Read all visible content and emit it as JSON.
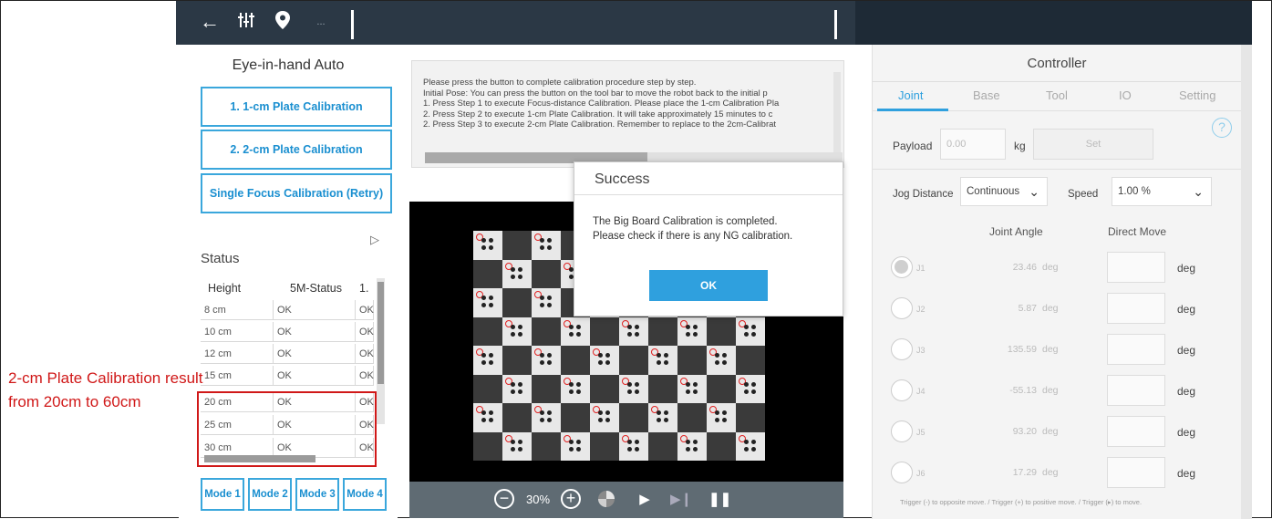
{
  "toolbar": {
    "back_icon": "arrow-left-icon",
    "sliders_icon": "sliders-icon",
    "location_icon": "map-pin-icon",
    "more_label": "..."
  },
  "left_panel": {
    "title": "Eye-in-hand Auto",
    "buttons": [
      "1. 1-cm Plate Calibration",
      "2. 2-cm Plate Calibration",
      "Single Focus Calibration (Retry)"
    ],
    "status_title": "Status",
    "columns": [
      "Height",
      "5M-Status",
      "1."
    ],
    "rows": [
      {
        "height": "8 cm",
        "status": "OK",
        "third": "OK"
      },
      {
        "height": "10 cm",
        "status": "OK",
        "third": "OK"
      },
      {
        "height": "12 cm",
        "status": "OK",
        "third": "OK"
      },
      {
        "height": "15 cm",
        "status": "OK",
        "third": "OK"
      },
      {
        "height": "20 cm",
        "status": "OK",
        "third": "OK"
      },
      {
        "height": "25 cm",
        "status": "OK",
        "third": "OK"
      },
      {
        "height": "30 cm",
        "status": "OK",
        "third": "OK"
      }
    ],
    "modes": [
      "Mode 1",
      "Mode 2",
      "Mode 3",
      "Mode 4"
    ]
  },
  "annotation": {
    "line1": "2-cm Plate Calibration result",
    "line2": "from 20cm to 60cm",
    "color": "#d01818"
  },
  "instructions": [
    "Please press the button to complete calibration procedure step by step.",
    "Initial Pose: You can press the button on the tool bar to move the robot back to the initial p",
    "1. Press Step 1 to execute Focus-distance Calibration. Please place the 1-cm Calibration Pla",
    "2. Press Step 2 to execute 1-cm Plate Calibration. It will take approximately 15 minutes to c",
    "2. Press Step 3 to execute 2-cm Plate Calibration. Remember to replace to the 2cm-Calibrat"
  ],
  "viewer": {
    "zoom": "30%",
    "zoom_out_icon": "zoom-out-icon",
    "zoom_in_icon": "zoom-in-icon"
  },
  "dialog": {
    "title": "Success",
    "line1": "The Big Board Calibration is completed.",
    "line2": "Please check if there is any NG calibration.",
    "ok_label": "OK"
  },
  "controller": {
    "title": "Controller",
    "tabs": [
      "Joint",
      "Base",
      "Tool",
      "IO",
      "Setting"
    ],
    "active_tab": "Joint",
    "help_label": "?",
    "payload_label": "Payload",
    "payload_value": "0.00",
    "payload_unit": "kg",
    "set_label": "Set",
    "jog_label": "Jog Distance",
    "jog_value": "Continuous",
    "speed_label": "Speed",
    "speed_value": "1.00 %",
    "col_angle": "Joint Angle",
    "col_direct": "Direct Move",
    "joints": [
      {
        "name": "J1",
        "value": "23.46",
        "unit": "deg",
        "direct_unit": "deg"
      },
      {
        "name": "J2",
        "value": "5.87",
        "unit": "deg",
        "direct_unit": "deg"
      },
      {
        "name": "J3",
        "value": "135.59",
        "unit": "deg",
        "direct_unit": "deg"
      },
      {
        "name": "J4",
        "value": "-55.13",
        "unit": "deg",
        "direct_unit": "deg"
      },
      {
        "name": "J5",
        "value": "93.20",
        "unit": "deg",
        "direct_unit": "deg"
      },
      {
        "name": "J6",
        "value": "17.29",
        "unit": "deg",
        "direct_unit": "deg"
      }
    ],
    "footer": "Trigger (-) to opposite move. / Trigger (+) to positive move. / Trigger (▸) to move.",
    "accent": "#2fa0de"
  }
}
